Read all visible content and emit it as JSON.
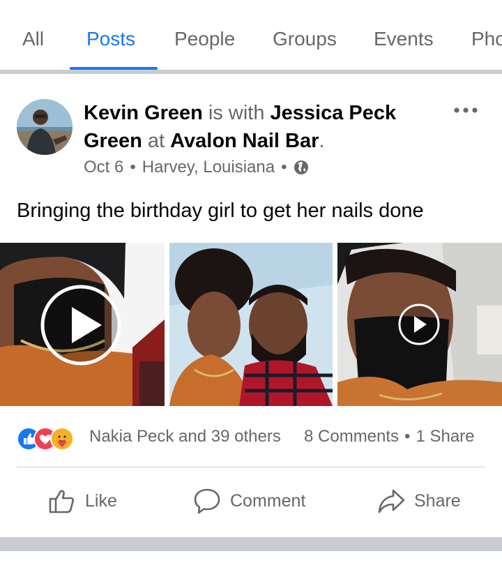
{
  "tabs": [
    {
      "label": "All",
      "active": false
    },
    {
      "label": "Posts",
      "active": true
    },
    {
      "label": "People",
      "active": false
    },
    {
      "label": "Groups",
      "active": false
    },
    {
      "label": "Events",
      "active": false
    },
    {
      "label": "Pho",
      "active": false
    }
  ],
  "post": {
    "author": "Kevin Green",
    "is_with": "is with",
    "tagged": "Jessica Peck Green",
    "at": "at",
    "place": "Avalon Nail Bar",
    "period": ".",
    "date": "Oct 6",
    "location": "Harvey, Louisiana",
    "separator": "•",
    "privacy_icon": "globe-icon",
    "text": "Bringing the birthday girl to get her nails done",
    "media": [
      {
        "type": "video",
        "icon": "play-icon"
      },
      {
        "type": "photo"
      },
      {
        "type": "video",
        "icon": "play-icon"
      }
    ],
    "reactions": {
      "icons": [
        "like-reaction-icon",
        "love-reaction-icon",
        "care-reaction-icon"
      ],
      "text": "Nakia Peck and 39 others",
      "comments": "8 Comments",
      "shares": "1 Share"
    },
    "actions": {
      "like": "Like",
      "comment": "Comment",
      "share": "Share"
    }
  },
  "colors": {
    "accent": "#1877f2",
    "muted": "#65676b",
    "divider": "#c9ccd1",
    "love": "#f33e58",
    "care": "#f7b125"
  }
}
